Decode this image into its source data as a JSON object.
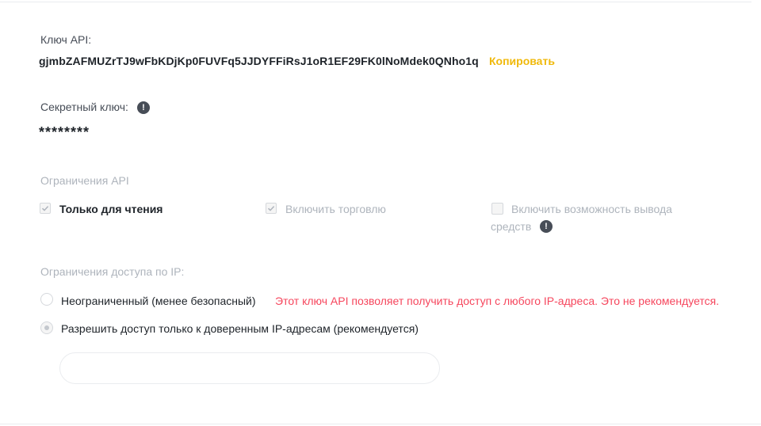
{
  "api_key": {
    "label": "Ключ API:",
    "value": "gjmbZAFMUZrTJ9wFbKDjKp0FUVFq5JJDYFFiRsJ1oR1EF29FK0lNoMdek0QNho1q",
    "copy_label": "Копировать"
  },
  "secret_key": {
    "label": "Секретный ключ:",
    "value": "********",
    "info_icon": "!"
  },
  "restrictions": {
    "title": "Ограничения API",
    "read_only": {
      "label": "Только для чтения",
      "checked": true
    },
    "enable_trading": {
      "label": "Включить торговлю",
      "checked": true,
      "disabled": true
    },
    "enable_withdrawals": {
      "label_line1": "Включить возможность вывода",
      "label_line2": "средств",
      "checked": false,
      "disabled": true,
      "info_icon": "!"
    }
  },
  "ip_access": {
    "title": "Ограничения доступа по IP:",
    "unrestricted": {
      "label": "Неограниченный (менее безопасный)",
      "warning": "Этот ключ API позволяет получить доступ с любого IP-адреса. Это не рекомендуется.",
      "selected": false
    },
    "trusted_only": {
      "label": "Разрешить доступ только к доверенным IP-адресам (рекомендуется)",
      "selected": true
    },
    "ip_input": {
      "value": "",
      "placeholder": ""
    }
  },
  "colors": {
    "accent": "#f0b90b",
    "warning": "#f6465d",
    "text": "#1e2329",
    "muted": "#aeb4bc"
  },
  "icons": {
    "copy": "copy-link",
    "info": "info-icon",
    "checkmark": "checkmark-icon"
  }
}
